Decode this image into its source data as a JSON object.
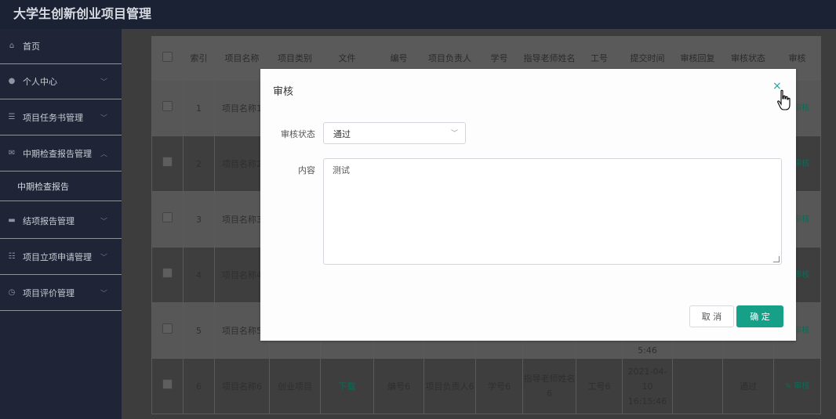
{
  "app": {
    "title": "大学生创新创业项目管理"
  },
  "sidebar": {
    "items": [
      {
        "label": "首页",
        "icon": "home-icon",
        "glyph": "⌂",
        "chevron": ""
      },
      {
        "label": "个人中心",
        "icon": "user-icon",
        "glyph": "●",
        "chevron": "﹀"
      },
      {
        "label": "项目任务书管理",
        "icon": "list-icon",
        "glyph": "☰",
        "chevron": "﹀"
      },
      {
        "label": "中期检查报告管理",
        "icon": "mail-icon",
        "glyph": "✉",
        "chevron": "︿"
      },
      {
        "label": "结项报告管理",
        "icon": "monitor-icon",
        "glyph": "▬",
        "chevron": "﹀"
      },
      {
        "label": "项目立项申请管理",
        "icon": "sliders-icon",
        "glyph": "☷",
        "chevron": "﹀"
      },
      {
        "label": "项目评价管理",
        "icon": "compass-icon",
        "glyph": "◷",
        "chevron": "﹀"
      }
    ],
    "subitem": "中期检查报告"
  },
  "table": {
    "headers": [
      "",
      "索引",
      "项目名称",
      "项目类别",
      "文件",
      "编号",
      "项目负责人",
      "学号",
      "指导老师姓名",
      "工号",
      "提交时间",
      "审核回复",
      "审核状态",
      "审核"
    ],
    "rows": [
      {
        "index": "1",
        "name": "项目名称1"
      },
      {
        "index": "2",
        "name": "项目名称2"
      },
      {
        "index": "3",
        "name": "项目名称3"
      },
      {
        "index": "4",
        "name": "项目名称4"
      },
      {
        "index": "5",
        "name": "项目名称5",
        "time_tail": "5:46"
      },
      {
        "index": "6",
        "name": "项目名称6",
        "category": "创业项目",
        "file": "下载",
        "number": "编号6",
        "leader": "项目负责人6",
        "student_id": "学号6",
        "teacher": "指导老师姓名6",
        "staff_id": "工号6",
        "time": "2021-04-10 16:15:46",
        "status": "通过"
      }
    ],
    "review_label": "审核"
  },
  "modal": {
    "title": "审核",
    "close_glyph": "×",
    "status_label": "审核状态",
    "status_value": "通过",
    "content_label": "内容",
    "content_value": "测试",
    "cancel_label": "取 消",
    "ok_label": "确 定"
  },
  "colors": {
    "accent": "#17a088",
    "sidebar": "#1f2536",
    "header": "#1b2233"
  }
}
